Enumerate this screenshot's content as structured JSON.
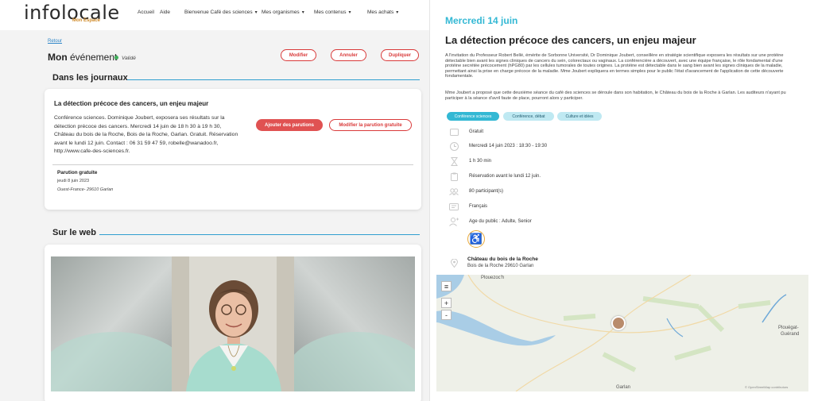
{
  "header": {
    "logo": "infolocale",
    "logo_sub": "Mon Espace",
    "nav": [
      {
        "label": "Accueil",
        "dropdown": false
      },
      {
        "label": "Aide",
        "dropdown": false
      },
      {
        "label": "Bienvenue Café des sciences",
        "dropdown": true
      },
      {
        "label": "Mes organismes",
        "dropdown": true
      },
      {
        "label": "Mes contenus",
        "dropdown": true
      },
      {
        "label": "Mes achats",
        "dropdown": true
      }
    ]
  },
  "event": {
    "back": "Retour",
    "title_bold": "Mon",
    "title_rest": " événement",
    "status": "Validé",
    "buttons": {
      "modify": "Modifier",
      "cancel": "Annuler",
      "duplicate": "Dupliquer"
    }
  },
  "journals": {
    "heading": "Dans les journaux",
    "card_title": "La détection précoce des cancers, un enjeu majeur",
    "card_text": "Conférence sciences. Dominique Joubert, exposera ses résultats sur la détection précoce des cancers. Mercredi 14 juin de 18 h 30 à 19 h 30, Château du bois de la Roche, Bois de la Roche, Garlan. Gratuit. Réservation avant le lundi 12 juin. Contact : 06 31 59 47 59, robelle@wanadoo.fr, http://www.cafe-des-sciences.fr.",
    "add_button": "Ajouter des parutions",
    "modify_free_button": "Modifier la parution gratuite",
    "pub_label": "Parution gratuite",
    "pub_date": "jeudi 8 juin 2023",
    "pub_source": "Ouest-France- 29610 Garlan"
  },
  "web": {
    "heading": "Sur le web"
  },
  "detail": {
    "date": "Mercredi 14 juin",
    "title": "La détection précoce des cancers, un enjeu majeur",
    "desc1": "A l'invitation du Professeur Robert Bellé, émérite de Sorbonne Université, Dr Dominique Joubert, conseillère en stratégie scientifique exposera les résultats sur une protéine détectable bien avant les signes cliniques de cancers du sein, colorectaux ou vaginaux. La conférencière a découvert, avec une équipe française, le rôle fondamental d'une protéine secrétée précocement (hPG80) par les cellules tumorales de toutes origines. La protéine est détectable dans le sang bien avant les signes cliniques de la maladie, permettant ainsi la prise en charge précoce de la maladie. Mme Joubert expliquera en termes simples pour le public l'état d'avancement de l'application de cette découverte fondamentale.",
    "desc2": "Mme Joubert a proposé que cette deuxième séance du café des sciences se déroule dans son habitation, le Château du bois de la Roche à Garlan. Les auditeurs n'ayant pu participer à la séance d'avril faute de place, pourront alors y participer.",
    "tags": [
      "Conférence sciences",
      "Conférence, débat",
      "Culture et idées"
    ],
    "info": [
      {
        "icon": "ticket-icon",
        "text": "Gratuit"
      },
      {
        "icon": "clock-icon",
        "text": "Mercredi 14 juin 2023 :  18:30 - 19:30"
      },
      {
        "icon": "hourglass-icon",
        "text": "1 h 30 min"
      },
      {
        "icon": "clipboard-icon",
        "text": "Réservation avant le lundi 12 juin."
      },
      {
        "icon": "people-icon",
        "text": "80 participant(s)"
      },
      {
        "icon": "language-icon",
        "text": "Français"
      },
      {
        "icon": "audience-icon",
        "text": "Age du public : Adulte, Senior"
      }
    ],
    "location_name": "Château du bois de la Roche",
    "location_addr": "Bois de la Roche 29610 Garlan",
    "map_labels": {
      "north": "Plouezoc'h",
      "east1": "Plouégat-",
      "east2": "Guérand",
      "south": "Garlan",
      "attrib": "© OpenStreetMap contributors"
    }
  },
  "colors": {
    "accent": "#33b8d4",
    "danger": "#e05252",
    "valid": "#3fae5a",
    "access": "#e8a93a"
  }
}
